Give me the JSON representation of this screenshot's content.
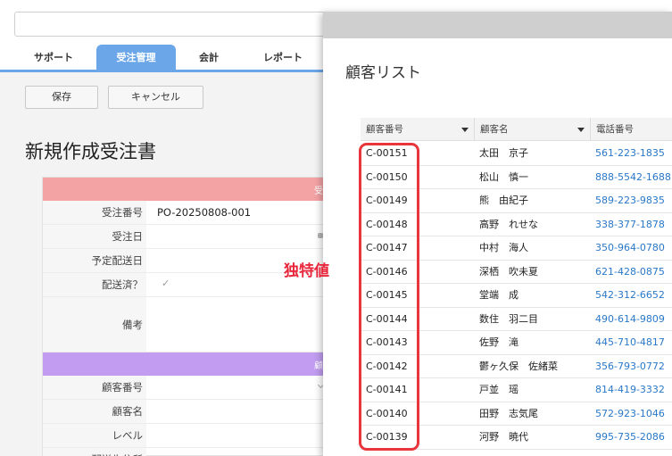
{
  "tabs": [
    {
      "label": "サポート"
    },
    {
      "label": "受注管理"
    },
    {
      "label": "会計"
    },
    {
      "label": "レポート"
    }
  ],
  "toolbar": {
    "save_label": "保存",
    "cancel_label": "キャンセル"
  },
  "page_title": "新規作成受注書",
  "form": {
    "section1_label": "受",
    "section2_label": "顧",
    "fields": [
      {
        "label": "受注番号",
        "value": "PO-20250808-001"
      },
      {
        "label": "受注日",
        "value": ""
      },
      {
        "label": "予定配送日",
        "value": ""
      },
      {
        "label": "配送済？",
        "value": "✓"
      },
      {
        "label": "備考",
        "value": ""
      },
      {
        "label": "顧客番号",
        "value": ""
      },
      {
        "label": "顧客名",
        "value": ""
      },
      {
        "label": "レベル",
        "value": ""
      },
      {
        "label": "配送先住所",
        "value": ""
      }
    ]
  },
  "customer_list": {
    "title": "顧客リスト",
    "columns": [
      "顧客番号",
      "顧客名",
      "電話番号"
    ],
    "rows": [
      {
        "id": "C-00151",
        "name": "太田　京子",
        "phone": "561-223-1835"
      },
      {
        "id": "C-00150",
        "name": "松山　慎一",
        "phone": "888-5542-1688"
      },
      {
        "id": "C-00149",
        "name": "熊　由紀子",
        "phone": "589-223-9835"
      },
      {
        "id": "C-00148",
        "name": "高野　れせな",
        "phone": "338-377-1878"
      },
      {
        "id": "C-00147",
        "name": "中村　海人",
        "phone": "350-964-0780"
      },
      {
        "id": "C-00146",
        "name": "深栖　吹未夏",
        "phone": "621-428-0875"
      },
      {
        "id": "C-00145",
        "name": "堂端　成",
        "phone": "542-312-6652"
      },
      {
        "id": "C-00144",
        "name": "数住　羽二目",
        "phone": "490-614-9809"
      },
      {
        "id": "C-00143",
        "name": "佐野　滝",
        "phone": "445-710-4817"
      },
      {
        "id": "C-00142",
        "name": "鬱ヶ久保　佐緒菜",
        "phone": "356-793-0772"
      },
      {
        "id": "C-00141",
        "name": "戸並　瑶",
        "phone": "814-419-3332"
      },
      {
        "id": "C-00140",
        "name": "田野　志気尾",
        "phone": "572-923-1046"
      },
      {
        "id": "C-00139",
        "name": "河野　暁代",
        "phone": "995-735-2086"
      }
    ]
  },
  "annotation": "独特値",
  "colors": {
    "accent": "#6aa6e8",
    "section1": "#f4a3a5",
    "section2": "#c29cf0",
    "highlight": "#e8363c",
    "link": "#2a78c8"
  }
}
